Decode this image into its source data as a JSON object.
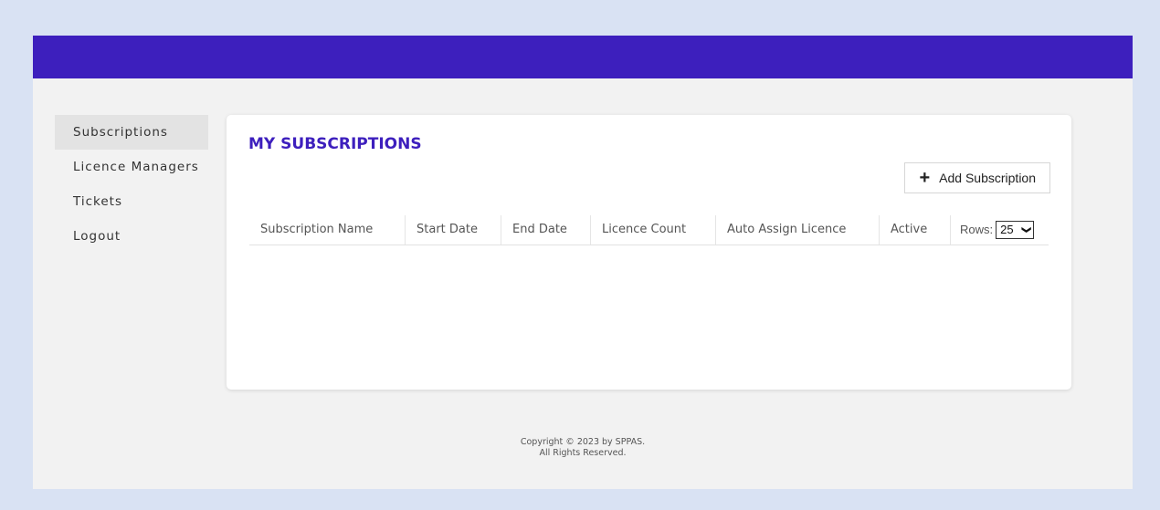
{
  "sidebar": {
    "items": [
      {
        "label": "Subscriptions"
      },
      {
        "label": "Licence Managers"
      },
      {
        "label": "Tickets"
      },
      {
        "label": "Logout"
      }
    ]
  },
  "main": {
    "title": "MY SUBSCRIPTIONS",
    "add_button_label": "Add Subscription",
    "add_button_icon": "plus-icon",
    "table": {
      "columns": [
        "Subscription Name",
        "Start Date",
        "End Date",
        "Licence Count",
        "Auto Assign Licence",
        "Active"
      ],
      "rows_label": "Rows:",
      "rows_value": "25",
      "rows": []
    }
  },
  "footer": {
    "line1": "Copyright © 2023 by SPPAS.",
    "line2": "All Rights Reserved."
  },
  "colors": {
    "brand": "#3d1fbd",
    "page_bg": "#d9e2f3",
    "content_bg": "#f2f2f2"
  }
}
